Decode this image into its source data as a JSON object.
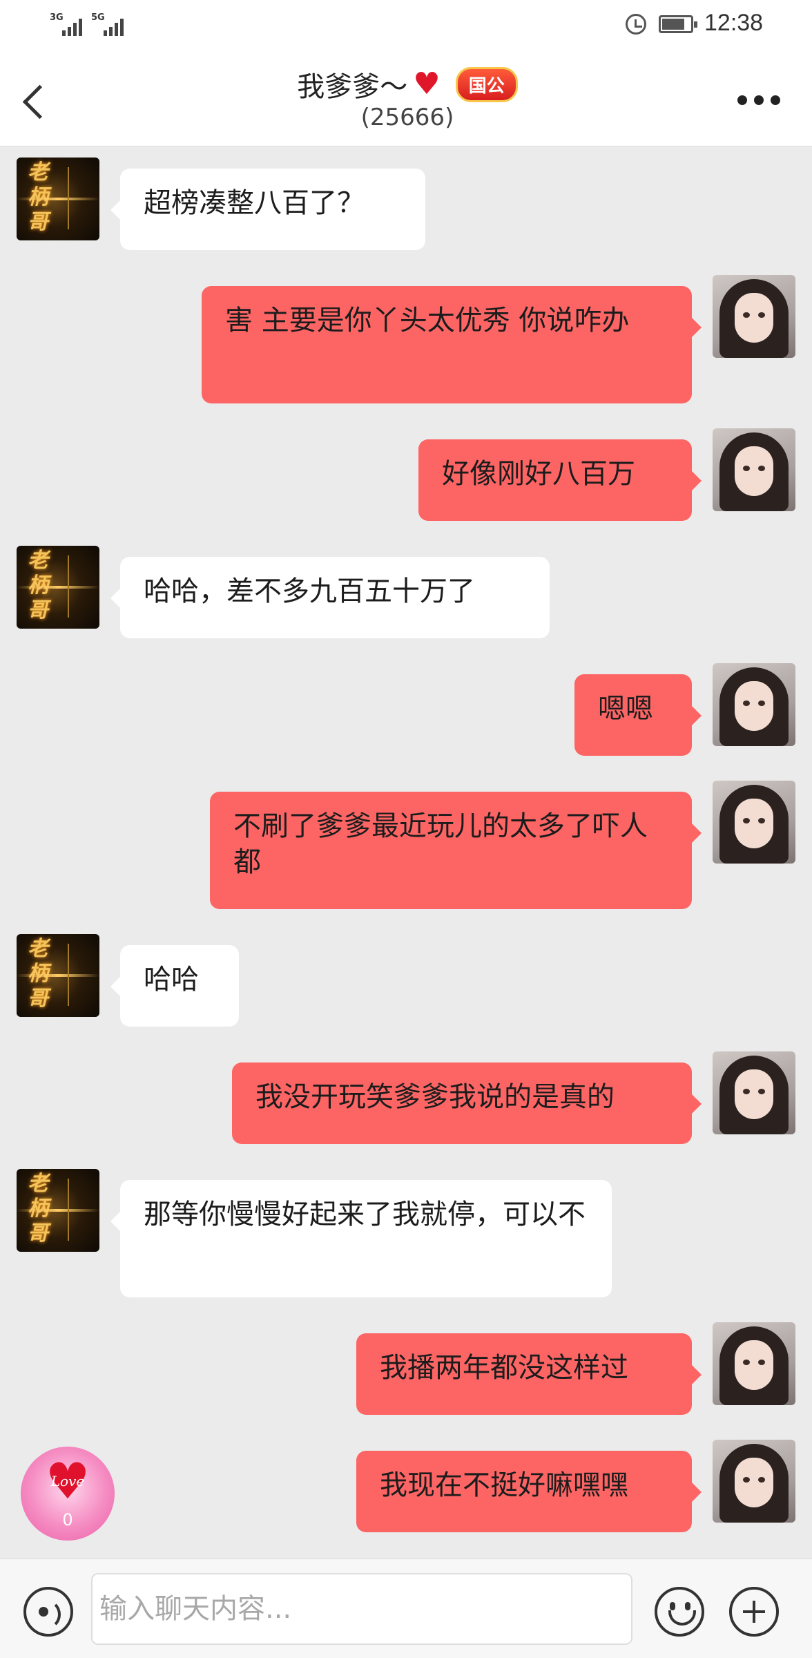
{
  "status_bar": {
    "signal_1": "3G",
    "signal_2": "5G",
    "time": "12:38"
  },
  "header": {
    "title": "我爹爹～",
    "title_icon": "heart-icon",
    "badge": "国公",
    "subtitle": "(25666)"
  },
  "messages": [
    {
      "side": "left",
      "text": "超榜凑整八百了？"
    },
    {
      "side": "right",
      "text": "害  主要是你丫头太优秀  你说咋办"
    },
    {
      "side": "right",
      "text": "好像刚好八百万"
    },
    {
      "side": "left",
      "text": "哈哈，差不多九百五十万了"
    },
    {
      "side": "right",
      "text": "嗯嗯"
    },
    {
      "side": "right",
      "text": "不刷了爹爹最近玩儿的太多了吓人都"
    },
    {
      "side": "left",
      "text": "哈哈"
    },
    {
      "side": "right",
      "text": "我没开玩笑爹爹我说的是真的"
    },
    {
      "side": "left",
      "text": "那等你慢慢好起来了我就停，可以不"
    },
    {
      "side": "right",
      "text": "我播两年都没这样过"
    },
    {
      "side": "right",
      "text": "我现在不挺好嘛嘿嘿"
    }
  ],
  "love_button": {
    "label": "Love",
    "count": "0"
  },
  "input_bar": {
    "placeholder": "输入聊天内容...",
    "value": ""
  },
  "colors": {
    "accent_bubble": "#fd6565",
    "background": "#ebebeb"
  }
}
